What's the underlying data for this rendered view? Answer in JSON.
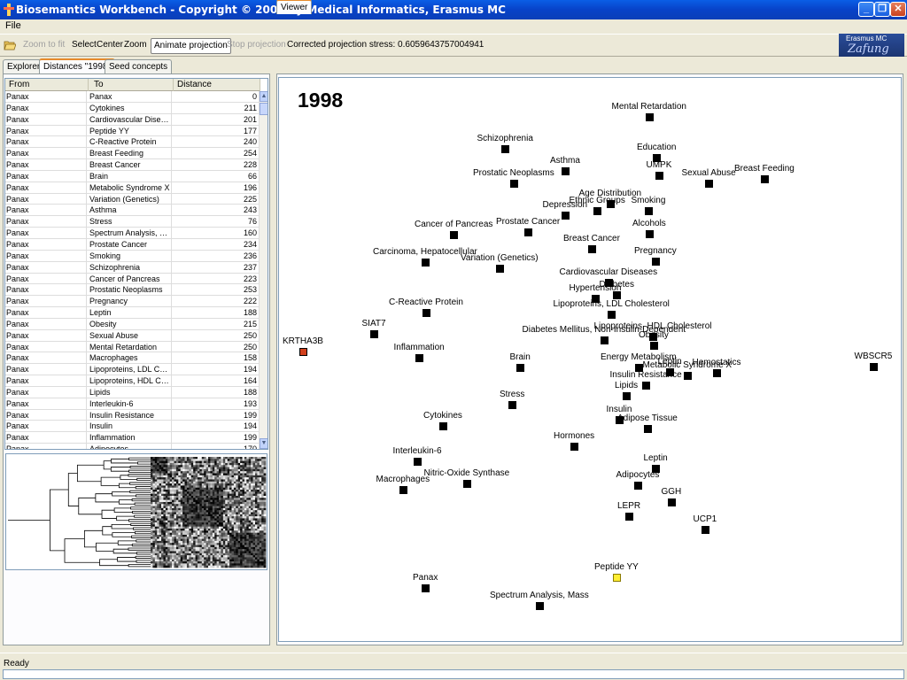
{
  "window": {
    "title": "Biosemantics Workbench - Copyright © 2005 by Medical Informatics, Erasmus MC"
  },
  "menu": {
    "file": "File"
  },
  "toolbar": {
    "zoom_to_fit": "Zoom to fit",
    "select": "Select",
    "center": "Center",
    "zoom": "Zoom",
    "animate": "Animate projection",
    "stop": "Stop projection",
    "stress": "Corrected projection stress: 0.6059643757004941"
  },
  "logo": {
    "line1": "Erasmus MC",
    "line2": "Zafung"
  },
  "tabs": {
    "explorer": "Explorer",
    "distances": "Distances \"1998\"",
    "seed": "Seed concepts",
    "viewer": "Viewer"
  },
  "table": {
    "headers": {
      "from": "From",
      "to": "To",
      "distance": "Distance"
    },
    "rows": [
      [
        "Panax",
        "Panax",
        "0"
      ],
      [
        "Panax",
        "Cytokines",
        "211"
      ],
      [
        "Panax",
        "Cardiovascular Diseases",
        "201"
      ],
      [
        "Panax",
        "Peptide YY",
        "177"
      ],
      [
        "Panax",
        "C-Reactive Protein",
        "240"
      ],
      [
        "Panax",
        "Breast Feeding",
        "254"
      ],
      [
        "Panax",
        "Breast Cancer",
        "228"
      ],
      [
        "Panax",
        "Brain",
        "66"
      ],
      [
        "Panax",
        "Metabolic Syndrome X",
        "196"
      ],
      [
        "Panax",
        "Variation (Genetics)",
        "225"
      ],
      [
        "Panax",
        "Asthma",
        "243"
      ],
      [
        "Panax",
        "Stress",
        "76"
      ],
      [
        "Panax",
        "Spectrum Analysis, M...",
        "160"
      ],
      [
        "Panax",
        "Prostate Cancer",
        "234"
      ],
      [
        "Panax",
        "Smoking",
        "236"
      ],
      [
        "Panax",
        "Schizophrenia",
        "237"
      ],
      [
        "Panax",
        "Cancer of Pancreas",
        "223"
      ],
      [
        "Panax",
        "Prostatic Neoplasms",
        "253"
      ],
      [
        "Panax",
        "Pregnancy",
        "222"
      ],
      [
        "Panax",
        "Leptin",
        "188"
      ],
      [
        "Panax",
        "Obesity",
        "215"
      ],
      [
        "Panax",
        "Sexual Abuse",
        "250"
      ],
      [
        "Panax",
        "Mental Retardation",
        "250"
      ],
      [
        "Panax",
        "Macrophages",
        "158"
      ],
      [
        "Panax",
        "Lipoproteins, LDL Cho...",
        "194"
      ],
      [
        "Panax",
        "Lipoproteins, HDL Ch...",
        "164"
      ],
      [
        "Panax",
        "Lipids",
        "188"
      ],
      [
        "Panax",
        "Interleukin-6",
        "193"
      ],
      [
        "Panax",
        "Insulin Resistance",
        "199"
      ],
      [
        "Panax",
        "Insulin",
        "194"
      ],
      [
        "Panax",
        "Inflammation",
        "199"
      ],
      [
        "Panax",
        "Adipocytes",
        "170"
      ]
    ]
  },
  "viewer": {
    "year": "1998",
    "colors": {
      "node": "#000000",
      "selected": "#ffee33",
      "highlight": "#d2401c"
    },
    "nodes": [
      {
        "label": "Mental Retardation",
        "state": "normal"
      },
      {
        "label": "Schizophrenia",
        "state": "normal"
      },
      {
        "label": "Education",
        "state": "normal"
      },
      {
        "label": "Asthma",
        "state": "normal"
      },
      {
        "label": "UMPK",
        "state": "normal"
      },
      {
        "label": "Breast Feeding",
        "state": "normal"
      },
      {
        "label": "Sexual Abuse",
        "state": "normal"
      },
      {
        "label": "Prostatic Neoplasms",
        "state": "normal"
      },
      {
        "label": "Age Distribution",
        "state": "normal"
      },
      {
        "label": "Ethnic Groups",
        "state": "normal"
      },
      {
        "label": "Smoking",
        "state": "normal"
      },
      {
        "label": "Depression",
        "state": "normal"
      },
      {
        "label": "Prostate Cancer",
        "state": "normal"
      },
      {
        "label": "Alcohols",
        "state": "normal"
      },
      {
        "label": "Cancer of Pancreas",
        "state": "normal"
      },
      {
        "label": "Breast Cancer",
        "state": "normal"
      },
      {
        "label": "Pregnancy",
        "state": "normal"
      },
      {
        "label": "Carcinoma, Hepatocellular",
        "state": "normal"
      },
      {
        "label": "Variation (Genetics)",
        "state": "normal"
      },
      {
        "label": "Cardiovascular Diseases",
        "state": "normal"
      },
      {
        "label": "Diabetes",
        "state": "normal"
      },
      {
        "label": "Hypertension",
        "state": "normal"
      },
      {
        "label": "C-Reactive Protein",
        "state": "normal"
      },
      {
        "label": "Lipoproteins, LDL Cholesterol",
        "state": "normal"
      },
      {
        "label": "SIAT7",
        "state": "normal"
      },
      {
        "label": "Lipoproteins, HDL Cholesterol",
        "state": "normal"
      },
      {
        "label": "Diabetes Mellitus, Non-Insulin-Dependent",
        "state": "normal"
      },
      {
        "label": "Obesity",
        "state": "normal"
      },
      {
        "label": "KRTHA3B",
        "state": "highlight"
      },
      {
        "label": "Inflammation",
        "state": "normal"
      },
      {
        "label": "Energy Metabolism",
        "state": "normal"
      },
      {
        "label": "Brain",
        "state": "normal"
      },
      {
        "label": "Leptin",
        "state": "normal"
      },
      {
        "label": "Hemostatics",
        "state": "normal"
      },
      {
        "label": "WBSCR5",
        "state": "normal"
      },
      {
        "label": "Metabolic Syndrome X",
        "state": "normal"
      },
      {
        "label": "Insulin Resistance",
        "state": "normal"
      },
      {
        "label": "Lipids",
        "state": "normal"
      },
      {
        "label": "Stress",
        "state": "normal"
      },
      {
        "label": "Cytokines",
        "state": "normal"
      },
      {
        "label": "Insulin",
        "state": "normal"
      },
      {
        "label": "Adipose Tissue",
        "state": "normal"
      },
      {
        "label": "Hormones",
        "state": "normal"
      },
      {
        "label": "Interleukin-6",
        "state": "normal"
      },
      {
        "label": "Leptin",
        "state": "normal"
      },
      {
        "label": "Nitric-Oxide Synthase",
        "state": "normal"
      },
      {
        "label": "Adipocytes",
        "state": "normal"
      },
      {
        "label": "Macrophages",
        "state": "normal"
      },
      {
        "label": "GGH",
        "state": "normal"
      },
      {
        "label": "LEPR",
        "state": "normal"
      },
      {
        "label": "UCP1",
        "state": "normal"
      },
      {
        "label": "Peptide YY",
        "state": "selected"
      },
      {
        "label": "Panax",
        "state": "normal"
      },
      {
        "label": "Spectrum Analysis, Mass",
        "state": "normal"
      }
    ]
  },
  "status": {
    "text": "Ready"
  }
}
